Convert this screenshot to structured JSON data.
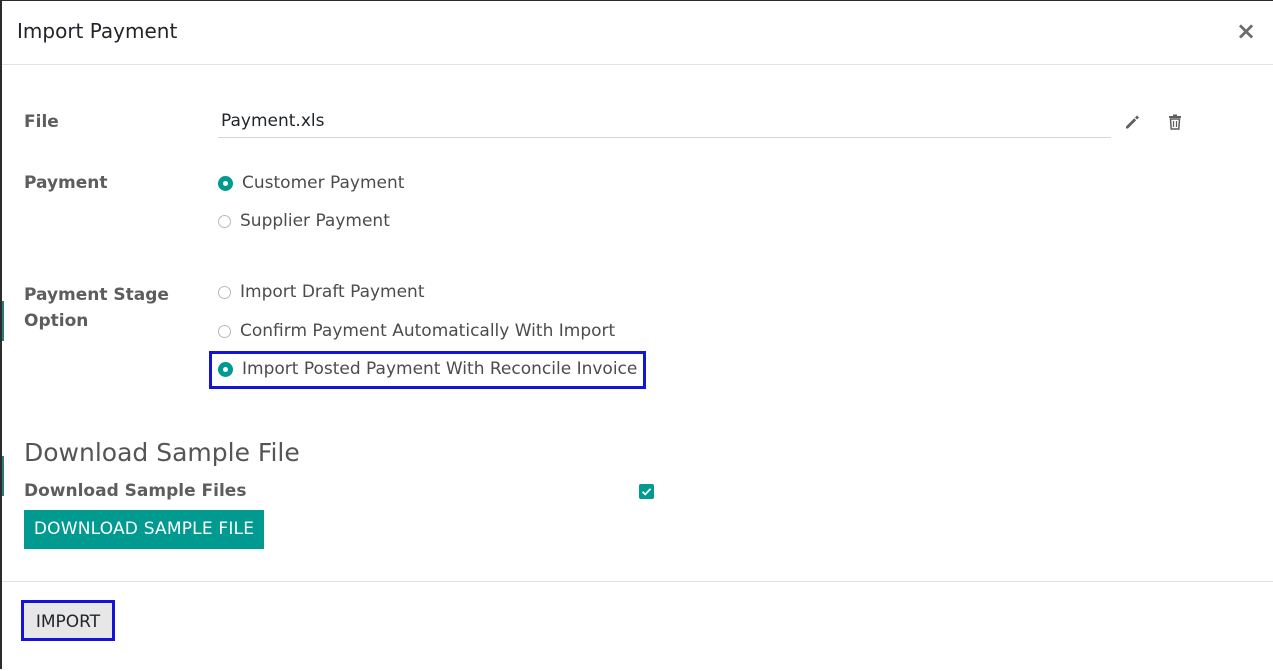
{
  "dialog": {
    "title": "Import Payment",
    "close_symbol": "×"
  },
  "file": {
    "label": "File",
    "value": "Payment.xls",
    "edit_icon": "pencil-icon",
    "delete_icon": "trash-icon"
  },
  "payment": {
    "label": "Payment",
    "options": [
      {
        "label": "Customer Payment",
        "checked": true
      },
      {
        "label": "Supplier Payment",
        "checked": false
      }
    ]
  },
  "stage": {
    "label_line1": "Payment Stage",
    "label_line2": "Option",
    "options": [
      {
        "label": "Import Draft Payment",
        "checked": false
      },
      {
        "label": "Confirm Payment Automatically With Import",
        "checked": false
      },
      {
        "label": "Import Posted Payment With Reconcile Invoice",
        "checked": true
      }
    ]
  },
  "sample": {
    "section_title": "Download Sample File",
    "checkbox_label": "Download Sample Files",
    "checkbox_checked": true,
    "button_label": "DOWNLOAD SAMPLE FILE"
  },
  "footer": {
    "import_label": "IMPORT"
  },
  "colors": {
    "accent": "#019a90",
    "highlight": "#1414d6"
  }
}
